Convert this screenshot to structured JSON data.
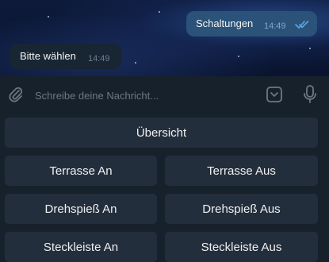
{
  "messages": [
    {
      "text": "Schaltungen",
      "time": "14:49",
      "direction": "outgoing",
      "status": "read"
    },
    {
      "text": "Bitte wählen",
      "time": "14:49",
      "direction": "incoming"
    }
  ],
  "composer": {
    "placeholder": "Schreibe deine Nachricht...",
    "icons": [
      "paperclip-icon",
      "keyboard-toggle-icon",
      "microphone-icon"
    ]
  },
  "keyboard": {
    "overview": "Übersicht",
    "rows": [
      {
        "left": "Terrasse An",
        "right": "Terrasse Aus"
      },
      {
        "left": "Drehspieß An",
        "right": "Drehspieß Aus"
      },
      {
        "left": "Steckleiste An",
        "right": "Steckleiste Aus"
      }
    ]
  },
  "colors": {
    "background": "#17212b",
    "outgoing_bubble": "#2b5278",
    "incoming_bubble": "#182533",
    "keyboard_button": "#232e3c",
    "icon": "#6c7883",
    "read_ticks": "#5ca5e0"
  }
}
